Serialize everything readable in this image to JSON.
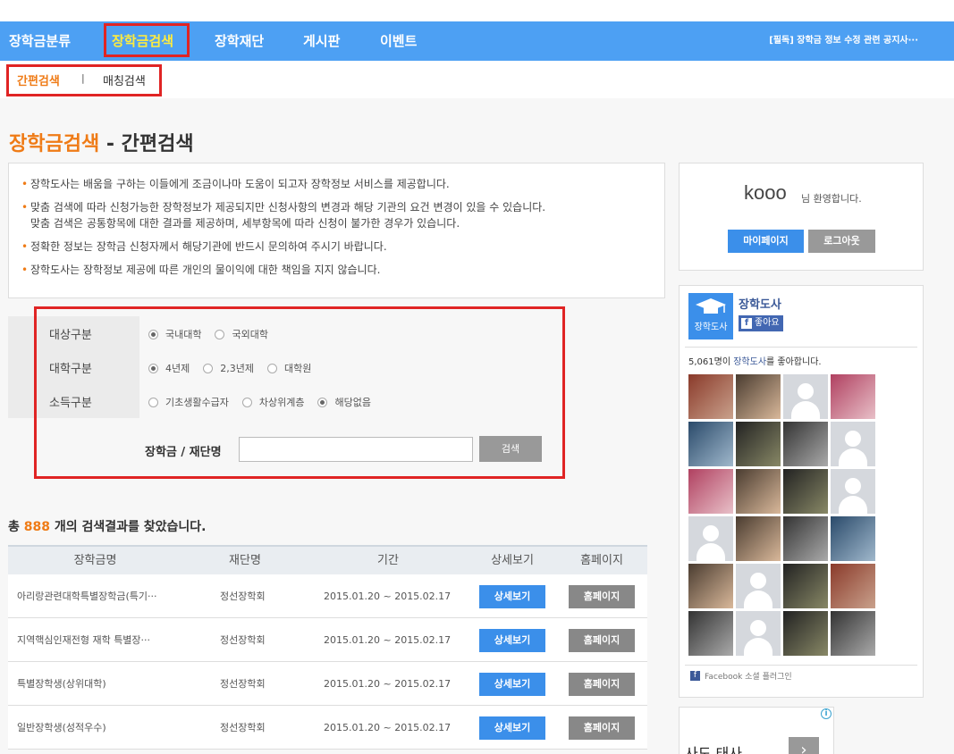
{
  "nav": {
    "items": [
      "장학금분류",
      "장학금검색",
      "장학재단",
      "게시판",
      "이벤트"
    ],
    "notice": "[필독] 장학금 정보 수정 관련 공지사···"
  },
  "subnav": {
    "items": [
      "간편검색",
      "매칭검색"
    ],
    "separator": "|"
  },
  "page": {
    "title_main": "장학금검색",
    "title_sub": " - 간편검색"
  },
  "notices": [
    "장학도사는 배움을 구하는 이들에게 조금이나마 도움이 되고자 장학정보 서비스를 제공합니다.",
    "맞춤 검색에 따라 신청가능한 장학정보가 제공되지만 신청사항의 변경과 해당 기관의 요건 변경이 있을 수 있습니다.",
    "맞춤 검색은 공통항목에 대한 결과를 제공하며, 세부항목에 따라 신청이 불가한 경우가 있습니다.",
    "정확한 정보는 장학금 신청자께서 해당기관에 반드시 문의하여 주시기 바랍니다.",
    "장학도사는 장학정보 제공에 따른 개인의 물이익에 대한 책임을 지지 않습니다."
  ],
  "filters": {
    "target_label": "대상구분",
    "target_options": [
      "국내대학",
      "국외대학"
    ],
    "univ_label": "대학구분",
    "univ_options": [
      "4년제",
      "2,3년제",
      "대학원"
    ],
    "income_label": "소득구분",
    "income_options": [
      "기초생활수급자",
      "차상위계층",
      "해당없음"
    ],
    "search_label": "장학금 / 재단명",
    "search_value": "",
    "search_button": "검색"
  },
  "results": {
    "prefix": "총 ",
    "count": "888",
    "suffix": " 개의 검색결과를 찾았습니다."
  },
  "table": {
    "headers": [
      "장학금명",
      "재단명",
      "기간",
      "상세보기",
      "홈페이지"
    ],
    "rows": [
      {
        "name": "아리랑관련대학특별장학금(특기···",
        "foundation": "정선장학회",
        "period": "2015.01.20 ~ 2015.02.17",
        "detail": "상세보기",
        "home": "홈페이지"
      },
      {
        "name": "지역핵심인재전형 재학 특별장···",
        "foundation": "정선장학회",
        "period": "2015.01.20 ~ 2015.02.17",
        "detail": "상세보기",
        "home": "홈페이지"
      },
      {
        "name": "특별장학생(상위대학)",
        "foundation": "정선장학회",
        "period": "2015.01.20 ~ 2015.02.17",
        "detail": "상세보기",
        "home": "홈페이지"
      },
      {
        "name": "일반장학생(성적우수)",
        "foundation": "정선장학회",
        "period": "2015.01.20 ~ 2015.02.17",
        "detail": "상세보기",
        "home": "홈페이지"
      }
    ]
  },
  "welcome": {
    "username": "kooo",
    "suffix": "님 환영합니다.",
    "mypage": "마이페이지",
    "logout": "로그아웃"
  },
  "facebook": {
    "page_name": "장학도사",
    "logo_text": "장학도사",
    "like": "좋아요",
    "count_prefix": "5,061명이 ",
    "count_link": "장학도사",
    "count_suffix": "를 좋아합니다.",
    "plugin": "Facebook 소셜 플러그인"
  },
  "ad": {
    "text": "사도 태사",
    "info": "i",
    "arrow": "›"
  }
}
